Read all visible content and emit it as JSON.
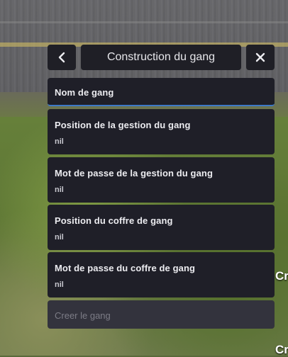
{
  "menu": {
    "title": "Construction du gang",
    "back_icon": "chevron-left-icon",
    "close_icon": "close-icon",
    "items": [
      {
        "label": "Nom de gang"
      },
      {
        "label": "Position de la gestion du gang",
        "value": "nil"
      },
      {
        "label": "Mot de passe de la gestion du gang",
        "value": "nil"
      },
      {
        "label": "Position du coffre de gang",
        "value": "nil"
      },
      {
        "label": "Mot de passe du coffre de gang",
        "value": "nil"
      }
    ],
    "submit_label": "Creer le gang"
  },
  "background": {
    "partial_text_1": "Cr",
    "partial_text_2": "Cr"
  },
  "colors": {
    "panel": "#1f1f28",
    "focus_border": "#3c78c8",
    "disabled_button": "#33333d"
  }
}
